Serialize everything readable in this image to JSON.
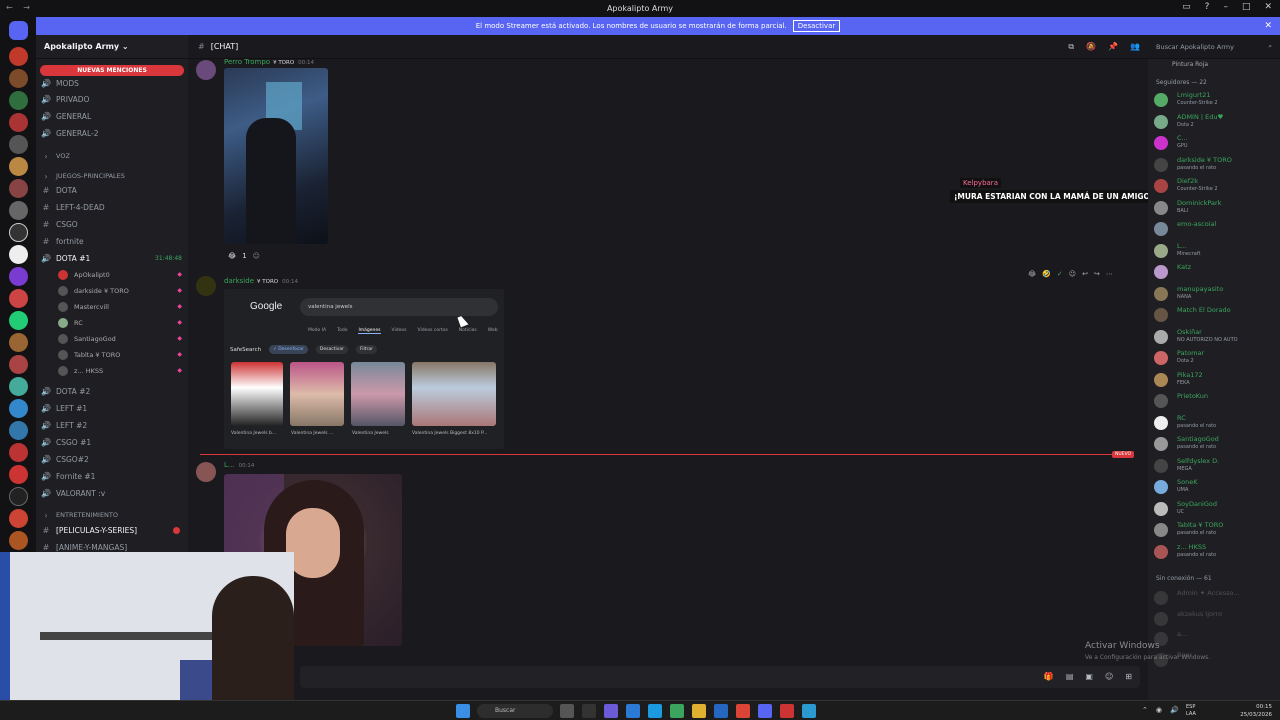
{
  "window": {
    "title": "Apokalipto Army"
  },
  "banner": {
    "text": "El modo Streamer está activado. Los nombres de usuario se mostrarán de forma parcial.",
    "button": "Desactivar"
  },
  "server": {
    "name": "Apokalipto Army ⌄",
    "mentions": "NUEVAS MENCIONES"
  },
  "channels": [
    {
      "name": "MODS"
    },
    {
      "name": "PRIVADO"
    },
    {
      "name": "GENERAL"
    },
    {
      "name": "GENERAL-2"
    }
  ],
  "cats": {
    "voz": "VOZ",
    "juegos": "JUEGOS-PRINCIPALES",
    "entretenimiento": "ENTRETENIMIENTO"
  },
  "game_channels": [
    "DOTA",
    "LEFT-4-DEAD",
    "CSGO",
    "fortnite"
  ],
  "voice": {
    "name": "DOTA #1",
    "time": "31:48:48"
  },
  "voice_members": [
    {
      "name": "ApOkalipt0",
      "tag": ""
    },
    {
      "name": "darkside",
      "tag": "¥ TORO"
    },
    {
      "name": "Mastercvill",
      "tag": ""
    },
    {
      "name": "RC",
      "tag": ""
    },
    {
      "name": "SantiagoGod",
      "tag": ""
    },
    {
      "name": "Tablta",
      "tag": "¥ TORO"
    },
    {
      "name": "z...",
      "tag": "HKSS"
    }
  ],
  "other_voice": [
    "DOTA #2",
    "LEFT #1",
    "LEFT #2",
    "CSGO #1",
    "CSGO#2",
    "Fornite #1",
    "VALORANT :v"
  ],
  "ent_channels": [
    "[PELICULAS-Y-SERIES]",
    "[ANIME-Y-MANGAS]"
  ],
  "header": {
    "channel": "[CHAT]",
    "search": "Buscar Apokalipto Army"
  },
  "msg1": {
    "author": "Perro Trompo",
    "tag": "¥ TORO",
    "time": "00:14",
    "reaction_count": "1"
  },
  "msg2": {
    "author": "darkside",
    "tag": "¥ TORO",
    "time": "00:14"
  },
  "google": {
    "logo": "Google",
    "query": "valentina jewels",
    "tabs": [
      "Modo IA",
      "Todo",
      "Imágenes",
      "Videos",
      "Videos cortos",
      "Noticias",
      "Web"
    ],
    "safesearch": "SafeSearch",
    "chip1": "✓ Desenfocar",
    "chip2": "Desactivar",
    "chip3": "Filtrar",
    "captions": [
      "Valentina Jewels b...",
      "Valentina Jewels ...",
      "Valentina Jewels",
      "Valentina Jewels Biggest 8x10 P..."
    ]
  },
  "newtag": "NUEVO",
  "msg3": {
    "author": "L...",
    "time": "00:14"
  },
  "overlay": {
    "user": "Kelpybara",
    "text": "¡MURA ESTARIAN CON LA MAMÁ DE UN AMIGO?"
  },
  "members": {
    "online_title": "Seguidores — 22",
    "offline_title": "Sin conexión — 61",
    "top_status": "Pintura Roja",
    "list": [
      {
        "name": "Lmigurt21",
        "status": "Counter-Strike 2",
        "color": "#3ba55d"
      },
      {
        "name": "ADMIN | Edu♥",
        "status": "Dota 2",
        "color": "#3ba55d"
      },
      {
        "name": "C...",
        "status": "GPU",
        "color": "#3ba55d"
      },
      {
        "name": "darkside ¥ TORO",
        "status": "pasando el rato",
        "color": "#3ba55d"
      },
      {
        "name": "Dief2k",
        "status": "Counter-Strike 2",
        "color": "#3ba55d"
      },
      {
        "name": "DominickPark",
        "status": "BALI",
        "color": "#3ba55d"
      },
      {
        "name": "emo-ascoial",
        "status": "",
        "color": "#3ba55d"
      },
      {
        "name": "L...",
        "status": "Minecraft",
        "color": "#3ba55d"
      },
      {
        "name": "Katz",
        "status": "",
        "color": "#3ba55d"
      },
      {
        "name": "manupayasito",
        "status": "NANA",
        "color": "#3ba55d"
      },
      {
        "name": "Match El Dorado",
        "status": "",
        "color": "#3ba55d"
      },
      {
        "name": "Oskiñar",
        "status": "NO AUTORIZO NO AUTO",
        "color": "#3ba55d"
      },
      {
        "name": "Patomar",
        "status": "Dota 2",
        "color": "#3ba55d"
      },
      {
        "name": "Pika172",
        "status": "FEKA",
        "color": "#3ba55d"
      },
      {
        "name": "PrietoKun",
        "status": "",
        "color": "#3ba55d"
      },
      {
        "name": "RC",
        "status": "pasando el rato",
        "color": "#3ba55d"
      },
      {
        "name": "SantiagoGod",
        "status": "pasando el rato",
        "color": "#3ba55d"
      },
      {
        "name": "Selfdyslex D.",
        "status": "MEGA",
        "color": "#3ba55d"
      },
      {
        "name": "SoneK",
        "status": "UMA",
        "color": "#3ba55d"
      },
      {
        "name": "SoyDaniGod",
        "status": "UC",
        "color": "#3ba55d"
      },
      {
        "name": "Tablta ¥ TORO",
        "status": "pasando el rato",
        "color": "#3ba55d"
      },
      {
        "name": "z... HKSS",
        "status": "pasando el rato",
        "color": "#3ba55d"
      }
    ],
    "offline": [
      {
        "name": "Admin ✦ Accesso..."
      },
      {
        "name": "akzekus Ijorro"
      },
      {
        "name": "a..."
      },
      {
        "name": "Beer"
      }
    ]
  },
  "watermark": {
    "line1": "Activar Windows",
    "line2": "Ve a Configuración para activar Windows."
  },
  "taskbar": {
    "search": "Buscar",
    "lang": "ESP\nLAA",
    "time": "00:15",
    "date": "25/03/2026"
  }
}
